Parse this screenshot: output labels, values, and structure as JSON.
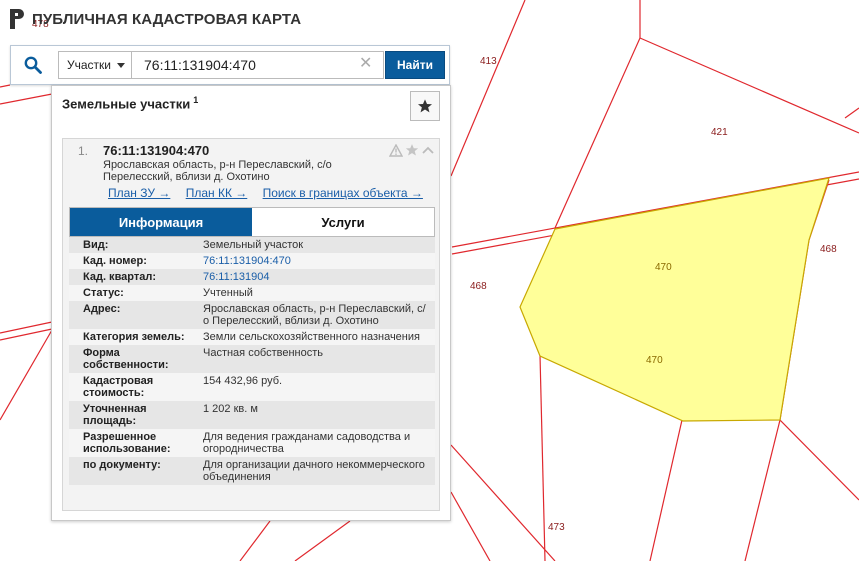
{
  "app": {
    "title": "ПУБЛИЧНАЯ КАДАСТРОВАЯ КАРТА"
  },
  "search": {
    "type_selected": "Участки",
    "query": "76:11:131904:470",
    "submit_label": "Найти"
  },
  "panel": {
    "title": "Земельные участки",
    "count": "1"
  },
  "result": {
    "index": "1.",
    "cad_number": "76:11:131904:470",
    "address_line1": "Ярославская область, р-н Переславский, с/о",
    "address_line2": "Перелесский, вблизи д. Охотино",
    "links": {
      "plan_zu": "План ЗУ →",
      "plan_kk": "План КК →",
      "search_bounds": "Поиск в границах объекта →"
    }
  },
  "tabs": {
    "info": "Информация",
    "services": "Услуги"
  },
  "info_rows": [
    {
      "label": "Вид:",
      "value": "Земельный участок"
    },
    {
      "label": "Кад. номер:",
      "value": "76:11:131904:470"
    },
    {
      "label": "Кад. квартал:",
      "value": "76:11:131904"
    },
    {
      "label": "Статус:",
      "value": "Учтенный"
    },
    {
      "label": "Адрес:",
      "value": "Ярославская область, р-н Переславский, с/о Перелесский, вблизи д. Охотино"
    },
    {
      "label": "Категория земель:",
      "value": "Земли сельскохозяйственного назначения"
    },
    {
      "label": "Форма собственности:",
      "value": "Частная собственность"
    },
    {
      "label": "Кадастровая стоимость:",
      "value": "154 432,96 руб."
    },
    {
      "label": "Уточненная площадь:",
      "value": "1 202 кв. м"
    },
    {
      "label": "Разрешенное использование:",
      "value": "Для ведения гражданами садоводства и огородничества"
    },
    {
      "label": "по документу:",
      "value": "Для организации дачного некоммерческого объединения"
    }
  ],
  "map": {
    "parcel_labels": {
      "p413": "413",
      "p421": "421",
      "p468a": "468",
      "p468b": "468",
      "p470a": "470",
      "p470b": "470",
      "p473": "473",
      "p478": "478"
    },
    "colors": {
      "boundary": "#e0282e",
      "selected_fill": "#ffff99",
      "selected_stroke": "#c8a800",
      "accent": "#0a5c9c"
    }
  }
}
